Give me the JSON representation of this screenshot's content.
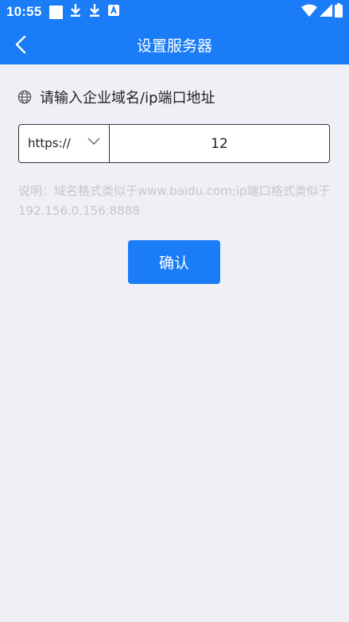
{
  "status_bar": {
    "time": "10:55",
    "left_icons": [
      "square-icon",
      "download-icon",
      "download-icon",
      "a-badge-icon"
    ],
    "right_icons": [
      "wifi-icon",
      "signal-icon",
      "battery-icon"
    ]
  },
  "header": {
    "title": "设置服务器",
    "background_color": "#1a7cf7"
  },
  "form": {
    "prompt_label": "请输入企业域名/ip端口地址",
    "protocol_selected": "https://",
    "address_value": "12",
    "hint": "说明：域名格式类似于www.baidu.com;ip端口格式类似于192.156.0.156:8888"
  },
  "actions": {
    "confirm_label": "确认"
  }
}
